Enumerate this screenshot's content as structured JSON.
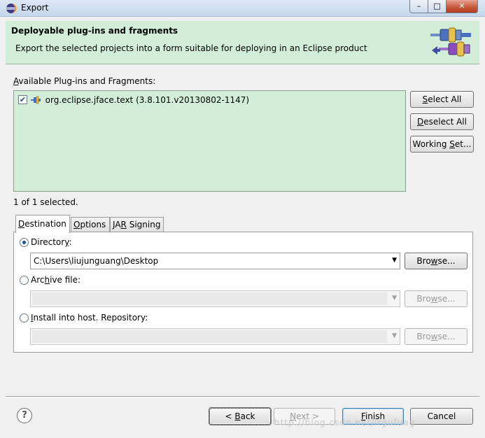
{
  "window": {
    "title": "Export",
    "minimize": "–",
    "maximize": "□",
    "close": "✕"
  },
  "header": {
    "title": "Deployable plug-ins and fragments",
    "description": "Export the selected projects into a form suitable for deploying in an Eclipse product"
  },
  "list": {
    "label_prefix": "",
    "label_mnemonic": "A",
    "label_rest": "vailable Plug-ins and Fragments:",
    "items": [
      {
        "checked": true,
        "label": "org.eclipse.jface.text (3.8.101.v20130802-1147)"
      }
    ]
  },
  "side_buttons": {
    "select_all": {
      "m": "S",
      "rest": "elect All"
    },
    "deselect_all": {
      "m": "D",
      "rest": "eselect All"
    },
    "working_set": {
      "pre": "Working ",
      "m": "S",
      "rest": "et..."
    }
  },
  "status": "1 of 1 selected.",
  "tabs": {
    "destination": {
      "m": "D",
      "rest": "estination"
    },
    "options": {
      "m": "O",
      "rest": "ptions"
    },
    "jar_signing": {
      "pre": "JA",
      "m": "R",
      "rest": " Signing"
    }
  },
  "destination": {
    "directory": {
      "label_pre": "Director",
      "label_m": "y",
      "label_rest": ":",
      "value": "C:\\Users\\liujunguang\\Desktop",
      "selected": true
    },
    "archive": {
      "label_pre": "Arc",
      "label_m": "h",
      "label_rest": "ive file:",
      "value": "",
      "selected": false
    },
    "repository": {
      "label_pre": "",
      "label_m": "I",
      "label_rest": "nstall into host. Repository:",
      "value": "",
      "selected": false
    },
    "browse": {
      "pre": "Bro",
      "m": "w",
      "rest": "se..."
    }
  },
  "footer": {
    "help": "?",
    "back": {
      "pre": "< ",
      "m": "B",
      "rest": "ack"
    },
    "next": {
      "pre": "",
      "m": "N",
      "rest": "ext >"
    },
    "finish": {
      "m": "F",
      "rest": "inish"
    },
    "cancel": "Cancel"
  },
  "watermark": "http://blog.csdn.net/lrgufuag"
}
